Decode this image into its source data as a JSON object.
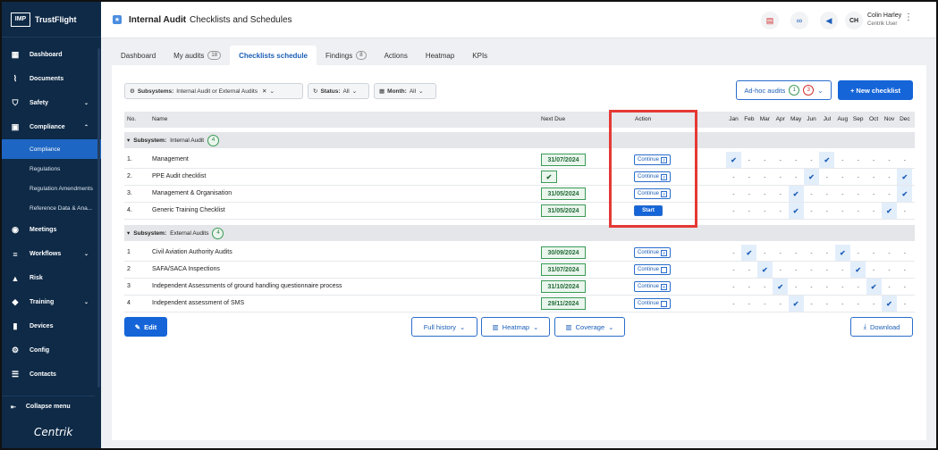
{
  "sidebar": {
    "brand_box": "IMP",
    "brand": "TrustFlight",
    "items": [
      {
        "label": "Dashboard",
        "icon": "dashboard-icon"
      },
      {
        "label": "Documents",
        "icon": "paperclip-icon"
      },
      {
        "label": "Safety",
        "icon": "shield-icon",
        "chevron": "⌄"
      },
      {
        "label": "Compliance",
        "icon": "compliance-icon",
        "chevron": "⌃"
      }
    ],
    "sub": [
      "Compliance",
      "Regulations",
      "Regulation Amendments",
      "Reference Data & Ana..."
    ],
    "items2": [
      {
        "label": "Meetings",
        "icon": "meetings-icon"
      },
      {
        "label": "Workflows",
        "icon": "workflows-icon",
        "chevron": "⌄"
      },
      {
        "label": "Risk",
        "icon": "risk-icon"
      },
      {
        "label": "Training",
        "icon": "training-icon",
        "chevron": "⌄"
      },
      {
        "label": "Devices",
        "icon": "devices-icon"
      },
      {
        "label": "Config",
        "icon": "config-icon"
      },
      {
        "label": "Contacts",
        "icon": "contacts-icon"
      }
    ],
    "collapse": "Collapse menu",
    "footer": "Centrik"
  },
  "topbar": {
    "title": "Internal Audit",
    "sep": "-",
    "subtitle": "Checklists and Schedules",
    "avatar": "CH",
    "user": "Colin Harley",
    "role": "Centrik User"
  },
  "tabs": [
    {
      "label": "Dashboard"
    },
    {
      "label": "My audits",
      "badge": "18"
    },
    {
      "label": "Checklists schedule",
      "active": true
    },
    {
      "label": "Findings",
      "badge": "8"
    },
    {
      "label": "Actions"
    },
    {
      "label": "Heatmap"
    },
    {
      "label": "KPIs"
    }
  ],
  "filters": {
    "subsystems_label": "Subsystems:",
    "subsystems_value": "Internal Audit or External Audits",
    "status_label": "Status:",
    "status_value": "All",
    "month_label": "Month:",
    "month_value": "All"
  },
  "adhoc": {
    "label": "Ad-hoc audits",
    "green": "1",
    "red": "3"
  },
  "new_checklist": "+ New checklist",
  "columns": {
    "no": "No.",
    "name": "Name",
    "due": "Next Due",
    "action": "Action"
  },
  "months": [
    "Jan",
    "Feb",
    "Mar",
    "Apr",
    "May",
    "Jun",
    "Jul",
    "Aug",
    "Sep",
    "Oct",
    "Nov",
    "Dec"
  ],
  "groups": [
    {
      "label": "Subsystem:",
      "name": "Internal Audit",
      "count": "4",
      "rows": [
        {
          "no": "1.",
          "name": "Management",
          "due": "31/07/2024",
          "action": "Continue",
          "action_badge": "2",
          "checks": [
            0,
            6
          ]
        },
        {
          "no": "2.",
          "name": "PPE Audit checklist",
          "due": "✔",
          "action": "Continue",
          "action_badge": "2",
          "checks": [
            5,
            11
          ]
        },
        {
          "no": "3.",
          "name": "Management & Organisation",
          "due": "31/05/2024",
          "action": "Continue",
          "action_badge": "2",
          "checks": [
            4,
            11
          ]
        },
        {
          "no": "4.",
          "name": "Generic Training Checklist",
          "due": "31/05/2024",
          "action": "Start",
          "action_badge": "",
          "checks": [
            4,
            10
          ]
        }
      ]
    },
    {
      "label": "Subsystem:",
      "name": "External Audits",
      "count": "4",
      "rows": [
        {
          "no": "1",
          "name": "Civil Aviation Authority Audits",
          "due": "30/09/2024",
          "action": "Continue",
          "action_badge": "2",
          "checks": [
            1,
            7
          ]
        },
        {
          "no": "2",
          "name": "SAFA/SACA Inspections",
          "due": "31/07/2024",
          "action": "Continue",
          "action_badge": "",
          "checks": [
            2,
            8
          ]
        },
        {
          "no": "3",
          "name": "Independent Assessments of ground handling questionnaire process",
          "due": "31/10/2024",
          "action": "Continue",
          "action_badge": "8",
          "checks": [
            3,
            9
          ]
        },
        {
          "no": "4",
          "name": "Independent assessment of SMS",
          "due": "29/11/2024",
          "action": "Continue",
          "action_badge": "",
          "checks": [
            4,
            10
          ]
        }
      ]
    }
  ],
  "dash": "-",
  "check": "✔",
  "buttons": {
    "edit": "Edit",
    "full_history": "Full history",
    "heatmap": "Heatmap",
    "coverage": "Coverage",
    "download": "Download"
  }
}
